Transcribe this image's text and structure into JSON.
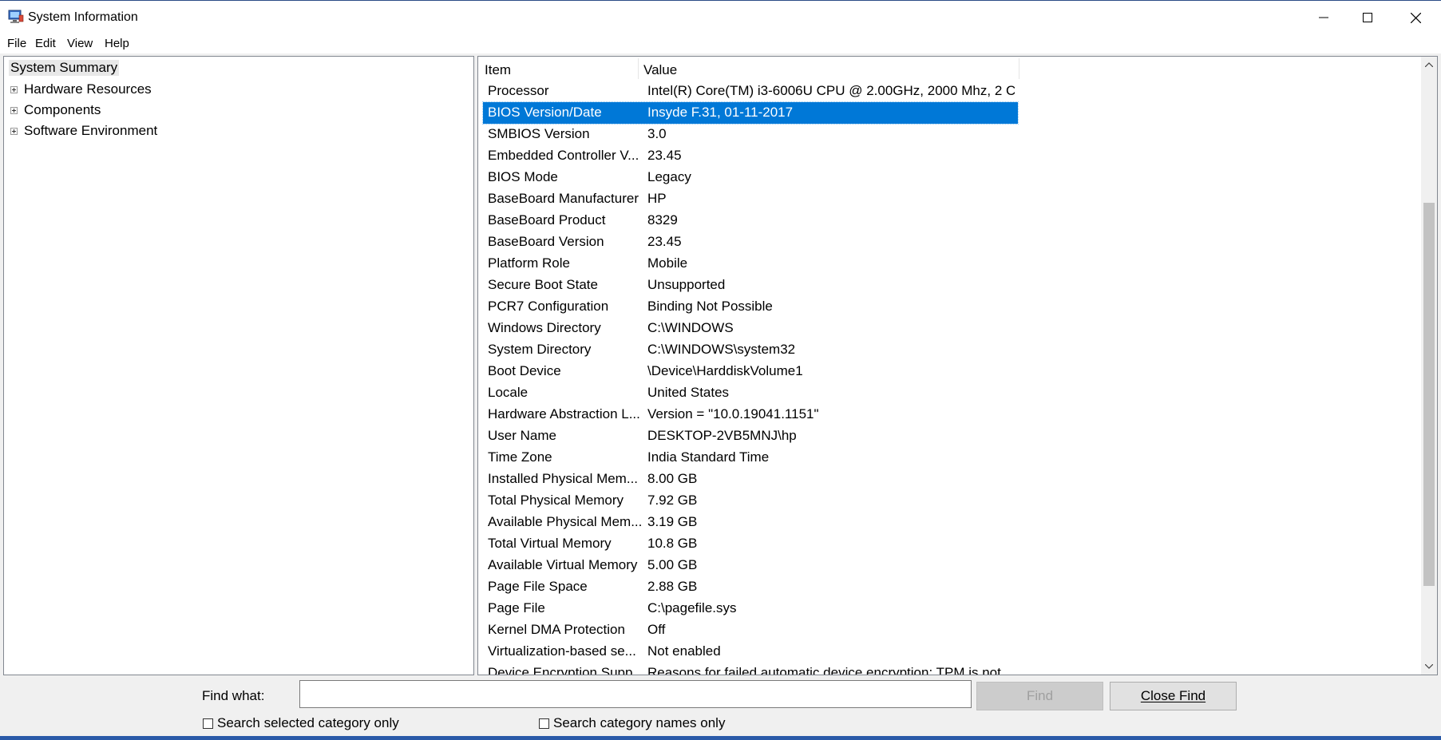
{
  "window": {
    "title": "System Information",
    "icon": "system-information-icon"
  },
  "menu": [
    "File",
    "Edit",
    "View",
    "Help"
  ],
  "tree": {
    "root": "System Summary",
    "children": [
      "Hardware Resources",
      "Components",
      "Software Environment"
    ]
  },
  "list": {
    "headers": {
      "item": "Item",
      "value": "Value"
    },
    "selected_index": 1,
    "rows": [
      {
        "item": "Processor",
        "value": "Intel(R) Core(TM) i3-6006U CPU @ 2.00GHz, 2000 Mhz, 2 C..."
      },
      {
        "item": "BIOS Version/Date",
        "value": "Insyde F.31, 01-11-2017"
      },
      {
        "item": "SMBIOS Version",
        "value": "3.0"
      },
      {
        "item": "Embedded Controller V...",
        "value": "23.45"
      },
      {
        "item": "BIOS Mode",
        "value": "Legacy"
      },
      {
        "item": "BaseBoard Manufacturer",
        "value": "HP"
      },
      {
        "item": "BaseBoard Product",
        "value": "8329"
      },
      {
        "item": "BaseBoard Version",
        "value": "23.45"
      },
      {
        "item": "Platform Role",
        "value": "Mobile"
      },
      {
        "item": "Secure Boot State",
        "value": "Unsupported"
      },
      {
        "item": "PCR7 Configuration",
        "value": "Binding Not Possible"
      },
      {
        "item": "Windows Directory",
        "value": "C:\\WINDOWS"
      },
      {
        "item": "System Directory",
        "value": "C:\\WINDOWS\\system32"
      },
      {
        "item": "Boot Device",
        "value": "\\Device\\HarddiskVolume1"
      },
      {
        "item": "Locale",
        "value": "United States"
      },
      {
        "item": "Hardware Abstraction L...",
        "value": "Version = \"10.0.19041.1151\""
      },
      {
        "item": "User Name",
        "value": "DESKTOP-2VB5MNJ\\hp"
      },
      {
        "item": "Time Zone",
        "value": "India Standard Time"
      },
      {
        "item": "Installed Physical Mem...",
        "value": "8.00 GB"
      },
      {
        "item": "Total Physical Memory",
        "value": "7.92 GB"
      },
      {
        "item": "Available Physical Mem...",
        "value": "3.19 GB"
      },
      {
        "item": "Total Virtual Memory",
        "value": "10.8 GB"
      },
      {
        "item": "Available Virtual Memory",
        "value": "5.00 GB"
      },
      {
        "item": "Page File Space",
        "value": "2.88 GB"
      },
      {
        "item": "Page File",
        "value": "C:\\pagefile.sys"
      },
      {
        "item": "Kernel DMA Protection",
        "value": "Off"
      },
      {
        "item": "Virtualization-based se...",
        "value": "Not enabled"
      },
      {
        "item": "Device Encryption Supp...",
        "value": "Reasons for failed automatic device encryption: TPM is not..."
      }
    ]
  },
  "find": {
    "label": "Find what:",
    "input_value": "",
    "find_button": "Find",
    "close_button": "Close Find",
    "check_selected": "Search selected category only",
    "check_names": "Search category names only"
  },
  "colors": {
    "selection": "#0078d7",
    "window_bg": "#f0f0f0"
  }
}
